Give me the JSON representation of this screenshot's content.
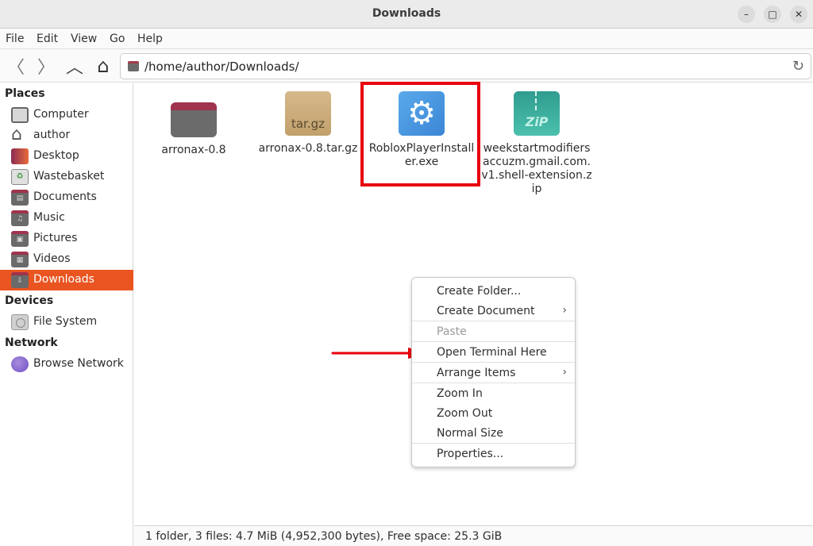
{
  "window": {
    "title": "Downloads",
    "controls": {
      "minimize": "–",
      "maximize": "□",
      "close": "✕"
    }
  },
  "menubar": [
    "File",
    "Edit",
    "View",
    "Go",
    "Help"
  ],
  "toolbar": {
    "back_icon": "〈",
    "forward_icon": "〉",
    "up_icon": "︿",
    "home_icon": "⌂",
    "location": "/home/author/Downloads/",
    "reload_icon": "↻"
  },
  "sidebar": {
    "places_heading": "Places",
    "places": [
      {
        "label": "Computer",
        "icon": "computer-icon"
      },
      {
        "label": "author",
        "icon": "home-icon"
      },
      {
        "label": "Desktop",
        "icon": "desktop-icon"
      },
      {
        "label": "Wastebasket",
        "icon": "trash-icon"
      },
      {
        "label": "Documents",
        "icon": "documents-folder-icon"
      },
      {
        "label": "Music",
        "icon": "music-folder-icon"
      },
      {
        "label": "Pictures",
        "icon": "pictures-folder-icon"
      },
      {
        "label": "Videos",
        "icon": "videos-folder-icon"
      },
      {
        "label": "Downloads",
        "icon": "downloads-folder-icon",
        "active": true
      }
    ],
    "devices_heading": "Devices",
    "devices": [
      {
        "label": "File System",
        "icon": "disk-icon"
      }
    ],
    "network_heading": "Network",
    "network": [
      {
        "label": "Browse Network",
        "icon": "network-icon"
      }
    ]
  },
  "files": [
    {
      "name": "arronax-0.8",
      "type": "folder"
    },
    {
      "name": "arronax-0.8.tar.gz",
      "type": "archive",
      "badge": "tar.gz"
    },
    {
      "name": "RobloxPlayerInstaller.exe",
      "type": "executable",
      "highlighted": true
    },
    {
      "name": "weekstartmodifiersaccuzm.gmail.com.v1.shell-extension.zip",
      "type": "zip",
      "badge": "ZiP"
    }
  ],
  "context_menu": {
    "items": [
      {
        "label": "Create Folder...",
        "enabled": true
      },
      {
        "label": "Create Document",
        "enabled": true,
        "submenu": true
      },
      {
        "label": "Paste",
        "enabled": false
      },
      {
        "label": "Open Terminal Here",
        "enabled": true,
        "annotated": true
      },
      {
        "label": "Arrange Items",
        "enabled": true,
        "submenu": true
      },
      {
        "label": "Zoom In",
        "enabled": true
      },
      {
        "label": "Zoom Out",
        "enabled": true
      },
      {
        "label": "Normal Size",
        "enabled": true
      },
      {
        "label": "Properties...",
        "enabled": true
      }
    ],
    "submenu_arrow": "›"
  },
  "annotation": {
    "color": "#e8000b"
  },
  "accent_color": "#e95420",
  "statusbar": {
    "text": "1 folder, 3 files: 4.7 MiB (4,952,300 bytes), Free space: 25.3 GiB"
  }
}
